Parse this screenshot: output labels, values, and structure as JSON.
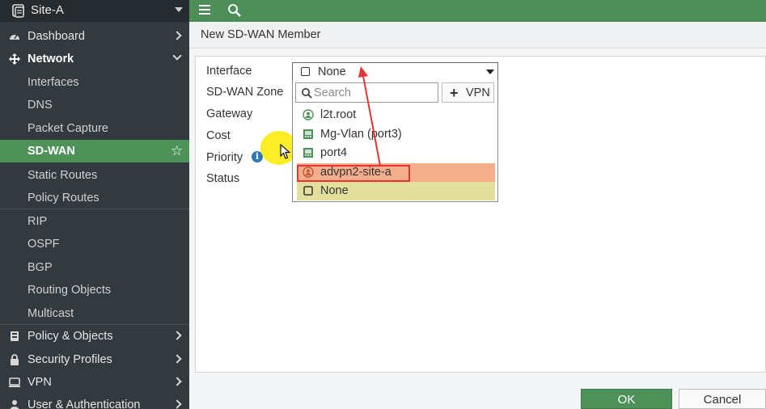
{
  "sidebar": {
    "site": "Site-A",
    "items": [
      {
        "label": "Dashboard",
        "icon": "dashboard-icon"
      },
      {
        "label": "Network",
        "icon": "network-icon"
      },
      {
        "label": "Interfaces"
      },
      {
        "label": "DNS"
      },
      {
        "label": "Packet Capture"
      },
      {
        "label": "SD-WAN"
      },
      {
        "label": "Static Routes"
      },
      {
        "label": "Policy Routes"
      },
      {
        "label": "RIP"
      },
      {
        "label": "OSPF"
      },
      {
        "label": "BGP"
      },
      {
        "label": "Routing Objects"
      },
      {
        "label": "Multicast"
      },
      {
        "label": "Policy & Objects",
        "icon": "policy-icon"
      },
      {
        "label": "Security Profiles",
        "icon": "lock-icon"
      },
      {
        "label": "VPN",
        "icon": "monitor-icon"
      },
      {
        "label": "User & Authentication",
        "icon": "user-icon"
      }
    ]
  },
  "page": {
    "title": "New SD-WAN Member"
  },
  "form": {
    "labels": {
      "interface": "Interface",
      "zone": "SD-WAN Zone",
      "gateway": "Gateway",
      "cost": "Cost",
      "priority": "Priority",
      "status": "Status"
    },
    "interface_value": "None",
    "search_placeholder": "Search",
    "vpn_button": "VPN",
    "options": [
      {
        "label": "l2t.root",
        "icon": "tunnel-user-icon"
      },
      {
        "label": "Mg-Vlan (port3)",
        "icon": "port-icon"
      },
      {
        "label": "port4",
        "icon": "port-icon"
      },
      {
        "label": "advpn2-site-a",
        "icon": "tunnel-user-icon"
      },
      {
        "label": "None",
        "icon": "checkbox-icon"
      }
    ]
  },
  "buttons": {
    "ok": "OK",
    "cancel": "Cancel"
  },
  "colors": {
    "brand_green": "#4e9159",
    "sidebar_bg": "#333a3f",
    "highlight_orange": "#f5ae8c",
    "selected_yellow": "#e2e09c",
    "annotation_red": "#e43535"
  }
}
